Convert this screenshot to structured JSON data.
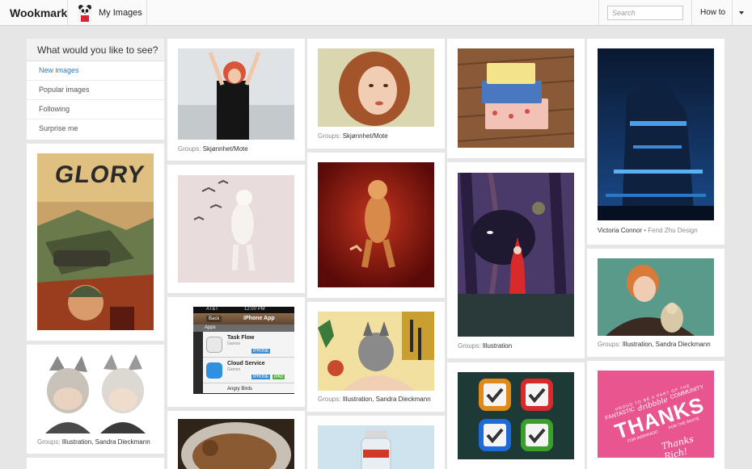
{
  "header": {
    "brand": "Wookmark",
    "my_images_label": "My Images",
    "search_placeholder": "Search",
    "howto_label": "How to"
  },
  "menu": {
    "heading": "What would you like to see?",
    "items": [
      {
        "label": "New images",
        "active": true
      },
      {
        "label": "Popular images",
        "active": false
      },
      {
        "label": "Following",
        "active": false
      },
      {
        "label": "Surprise me",
        "active": false
      }
    ]
  },
  "cards": {
    "dancer": {
      "groups_label": "Groups:",
      "groups": "Skjønnhet/Mote"
    },
    "redhead": {
      "groups_label": "Groups:",
      "groups": "Skjønnhet/Mote"
    },
    "wolf": {
      "groups_label": "Groups:",
      "groups": "Illustration, Sandra Dieckmann"
    },
    "riding_hood": {
      "groups_label": "Groups:",
      "groups": "Illustration"
    },
    "city": {
      "author": "Victoria Connor",
      "bullet": "•",
      "source": "Fend Zhu Design"
    },
    "boy_owl": {
      "groups_label": "Groups:",
      "groups": "Illustration, Sandra Dieckmann"
    },
    "cat_masks": {
      "groups_label": "Groups:",
      "groups": "Illustration, Sandra Dieckmann"
    }
  },
  "comic": {
    "title": "GLORY"
  },
  "phone": {
    "status_carrier": "AT&T",
    "status_time": "12:00 PM",
    "nav_back": "Back",
    "nav_title": "iPhone App",
    "section": "Apps",
    "apps": [
      {
        "name": "Task Flow",
        "category": "Games",
        "badges": [
          "IPHONE"
        ]
      },
      {
        "name": "Cloud Service",
        "category": "Games",
        "badges": [
          "IPHONE",
          "IPAD"
        ]
      },
      {
        "name": "Angry Birds",
        "category": "",
        "badges": []
      }
    ]
  },
  "thanks": {
    "line1": "PROUD TO BE A PART OF THE",
    "dribbble": "dribbble",
    "community": "COMMUNITY",
    "fantastic": "FANTASTIC",
    "big": "THANKS",
    "for_invite": "FOR THE INVITE",
    "inspirado": "FOR INSPIRADO",
    "signature": "Thanks Rich!"
  },
  "colors": {
    "accent": "#2a7ab8",
    "background": "#e6e6e6",
    "card": "#ffffff"
  }
}
